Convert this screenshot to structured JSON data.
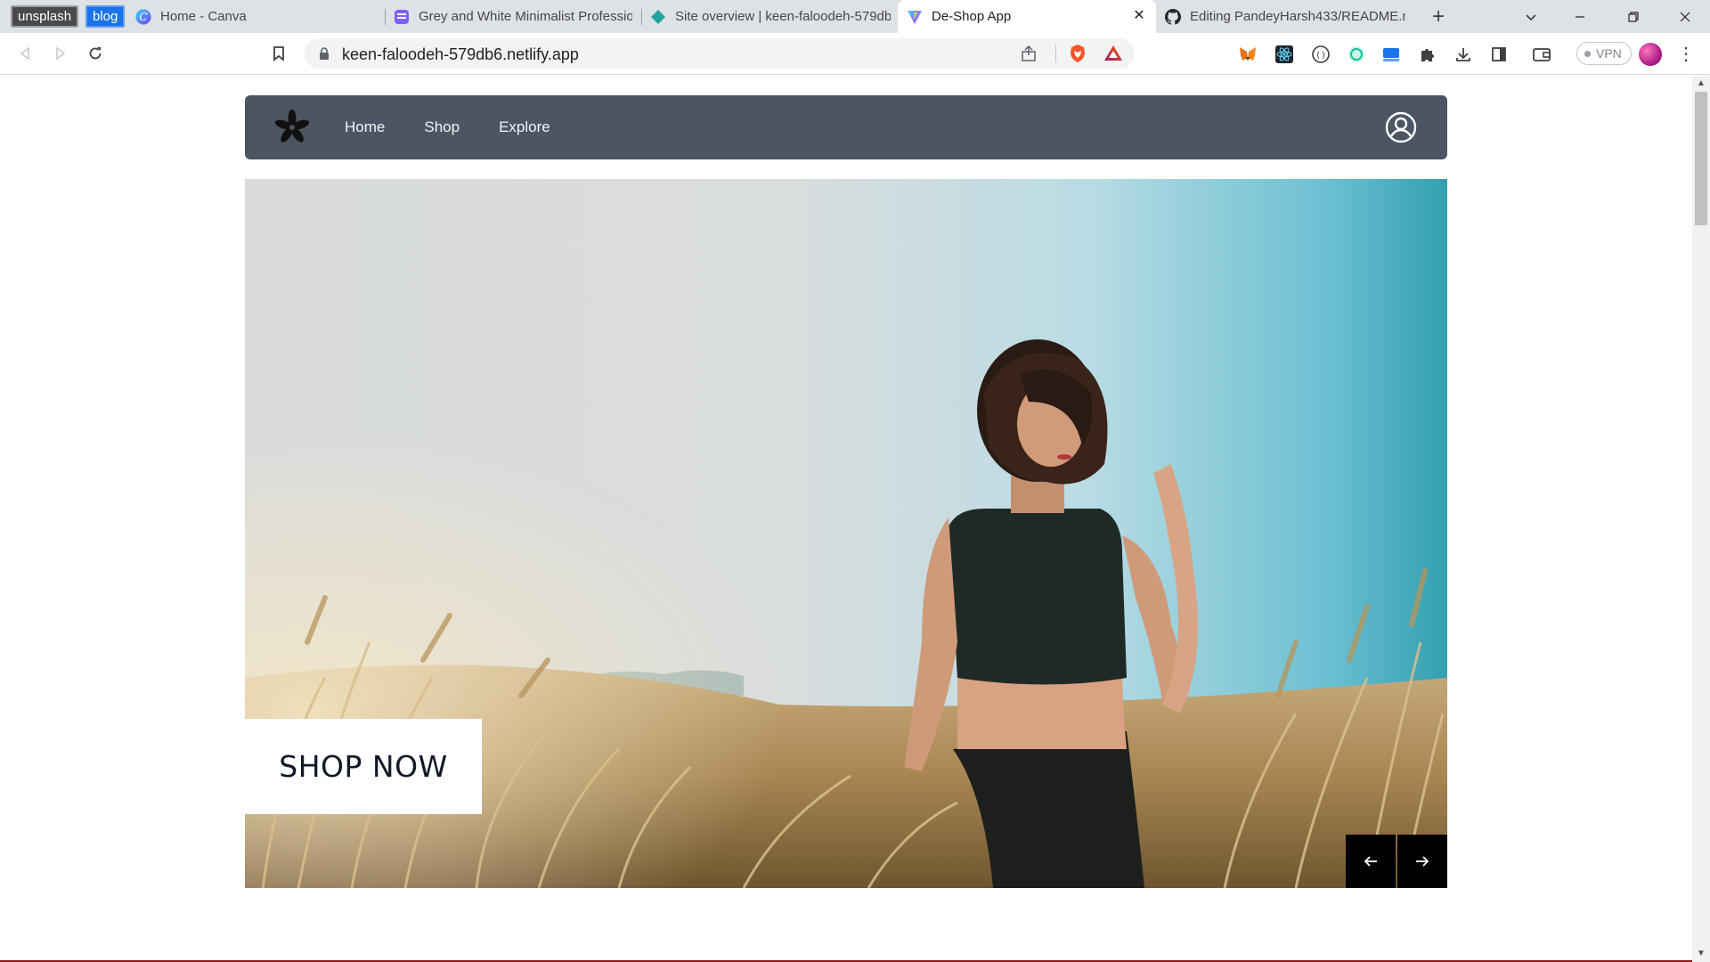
{
  "browser": {
    "bookmarks": [
      {
        "label": "unsplash"
      },
      {
        "label": "blog"
      }
    ],
    "tabs": [
      {
        "title": "Home - Canva",
        "icon": "canva-icon"
      },
      {
        "title": "Grey and White Minimalist Professio",
        "icon": "document-icon"
      },
      {
        "title": "Site overview | keen-faloodeh-579db",
        "icon": "netlify-icon"
      },
      {
        "title": "De-Shop App",
        "icon": "vite-icon",
        "active": true
      },
      {
        "title": "Editing PandeyHarsh433/README.m",
        "icon": "github-icon"
      }
    ],
    "url": "keen-faloodeh-579db6.netlify.app",
    "vpn_label": "VPN"
  },
  "site": {
    "nav": {
      "links": [
        "Home",
        "Shop",
        "Explore"
      ],
      "logo_icon": "flower-logo-icon",
      "account_icon": "user-account-icon",
      "bg_color": "#4b5563"
    },
    "hero": {
      "cta_label": "SHOP NOW",
      "prev_icon": "arrow-left-icon",
      "next_icon": "arrow-right-icon"
    }
  }
}
